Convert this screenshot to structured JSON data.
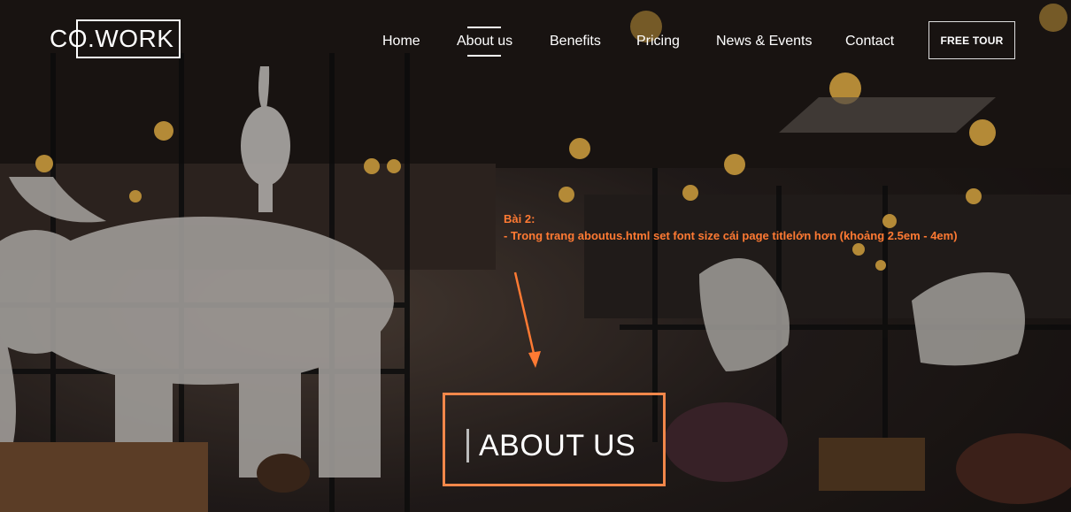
{
  "brand": {
    "logo_text": "CO.WORK"
  },
  "nav": {
    "items": [
      {
        "label": "Home"
      },
      {
        "label": "About us"
      },
      {
        "label": "Benefits"
      },
      {
        "label": "Pricing"
      },
      {
        "label": "News & Events"
      },
      {
        "label": "Contact"
      }
    ],
    "active": "About us",
    "cta_label": "FREE TOUR"
  },
  "annotation": {
    "line1": "Bài 2:",
    "line2": "- Trong trang aboutus.html set font size cái page titlelớn hơn (khoảng 2.5em - 4em)",
    "color": "#ff7a33"
  },
  "hero": {
    "page_title": "ABOUT US"
  },
  "colors": {
    "accent": "#f2874a",
    "text": "#ffffff"
  }
}
